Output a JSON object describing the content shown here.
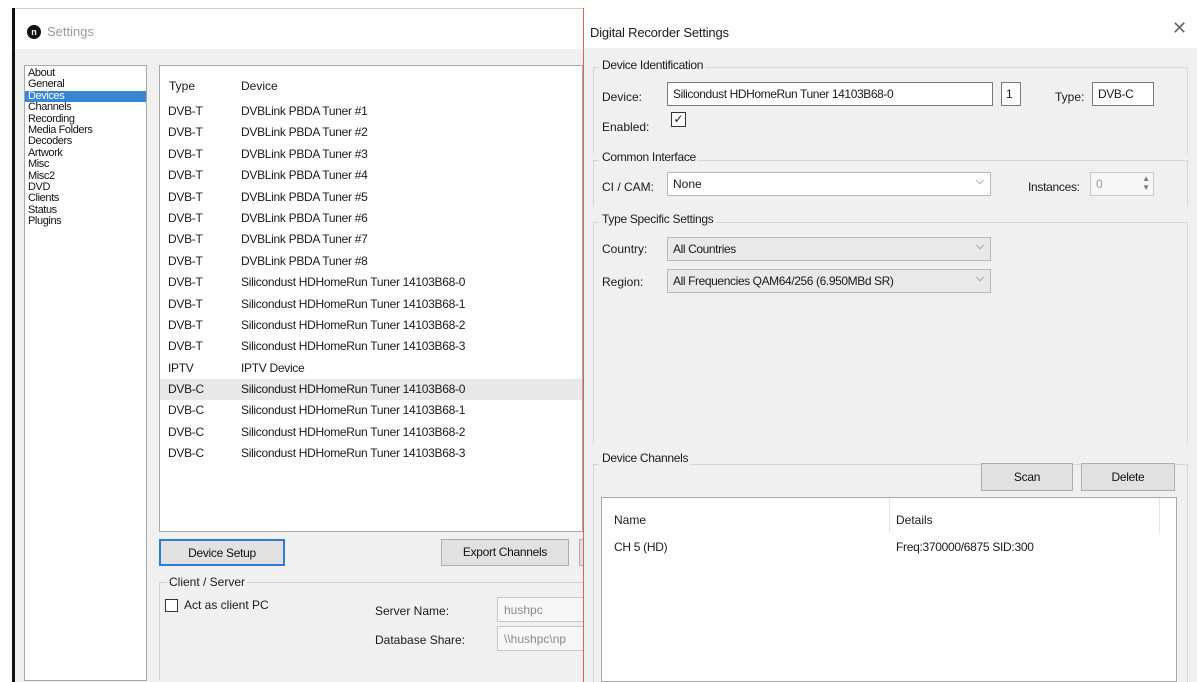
{
  "settings": {
    "title": "Settings",
    "logo_letter": "n",
    "nav": [
      "About",
      "General",
      "Devices",
      "Channels",
      "Recording",
      "Media Folders",
      "Decoders",
      "Artwork",
      "Misc",
      "Misc2",
      "DVD",
      "Clients",
      "Status",
      "Plugins"
    ],
    "selected_nav": "Devices",
    "device_list": {
      "headers": {
        "type": "Type",
        "device": "Device"
      },
      "rows": [
        {
          "type": "DVB-T",
          "device": "DVBLink PBDA Tuner #1"
        },
        {
          "type": "DVB-T",
          "device": "DVBLink PBDA Tuner #2"
        },
        {
          "type": "DVB-T",
          "device": "DVBLink PBDA Tuner #3"
        },
        {
          "type": "DVB-T",
          "device": "DVBLink PBDA Tuner #4"
        },
        {
          "type": "DVB-T",
          "device": "DVBLink PBDA Tuner #5"
        },
        {
          "type": "DVB-T",
          "device": "DVBLink PBDA Tuner #6"
        },
        {
          "type": "DVB-T",
          "device": "DVBLink PBDA Tuner #7"
        },
        {
          "type": "DVB-T",
          "device": "DVBLink PBDA Tuner #8"
        },
        {
          "type": "DVB-T",
          "device": "Silicondust HDHomeRun Tuner 14103B68-0"
        },
        {
          "type": "DVB-T",
          "device": "Silicondust HDHomeRun Tuner 14103B68-1"
        },
        {
          "type": "DVB-T",
          "device": "Silicondust HDHomeRun Tuner 14103B68-2"
        },
        {
          "type": "DVB-T",
          "device": "Silicondust HDHomeRun Tuner 14103B68-3"
        },
        {
          "type": "IPTV",
          "device": "IPTV Device"
        },
        {
          "type": "DVB-C",
          "device": "Silicondust HDHomeRun Tuner 14103B68-0"
        },
        {
          "type": "DVB-C",
          "device": "Silicondust HDHomeRun Tuner 14103B68-1"
        },
        {
          "type": "DVB-C",
          "device": "Silicondust HDHomeRun Tuner 14103B68-2"
        },
        {
          "type": "DVB-C",
          "device": "Silicondust HDHomeRun Tuner 14103B68-3"
        }
      ],
      "selected_row": 13
    },
    "buttons": {
      "device_setup": "Device Setup",
      "export_channels": "Export Channels"
    },
    "client_server": {
      "legend": "Client / Server",
      "act_as_client_label": "Act as client PC",
      "act_as_client_checked": false,
      "server_name_label": "Server Name:",
      "server_name_value": "hushpc",
      "database_share_label": "Database Share:",
      "database_share_value": "\\\\hushpc\\np"
    }
  },
  "dialog": {
    "title": "Digital Recorder Settings",
    "close_icon": "close-icon",
    "device_identification": {
      "legend": "Device Identification",
      "device_label": "Device:",
      "device_value": "Silicondust HDHomeRun Tuner 14103B68-0",
      "index_value": "1",
      "type_label": "Type:",
      "type_value": "DVB-C",
      "enabled_label": "Enabled:",
      "enabled_checked": true,
      "check_glyph": "☑"
    },
    "common_interface": {
      "legend": "Common Interface",
      "cicam_label": "CI / CAM:",
      "cicam_value": "None",
      "instances_label": "Instances:",
      "instances_value": "0"
    },
    "type_specific": {
      "legend": "Type Specific Settings",
      "country_label": "Country:",
      "country_value": "All Countries",
      "region_label": "Region:",
      "region_value": "All Frequencies QAM64/256 (6.950MBd SR)"
    },
    "device_channels": {
      "legend": "Device Channels",
      "scan_label": "Scan",
      "delete_label": "Delete",
      "headers": {
        "name": "Name",
        "details": "Details"
      },
      "rows": [
        {
          "name": "CH 5 (HD)",
          "details": "Freq:370000/6875 SID:300"
        }
      ]
    }
  },
  "colors": {
    "selection": "#3a85d6",
    "focus_border": "#2f7bd1",
    "dialog_edge": "#e06060"
  }
}
